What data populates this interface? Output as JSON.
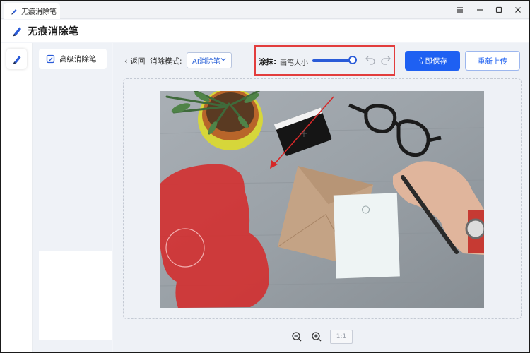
{
  "window": {
    "tab_title": "无痕消除笔",
    "icons": [
      "minimize-icon",
      "maximize-icon",
      "close-icon",
      "menu-icon"
    ]
  },
  "header": {
    "title": "无痕消除笔",
    "logo_icon": "pen-icon"
  },
  "sidebar": {
    "items": [
      {
        "label": "高级消除笔",
        "icon": "edit-icon"
      }
    ]
  },
  "toolbar": {
    "back_label": "返回",
    "mode_label": "消除模式:",
    "mode_value": "AI消除笔",
    "paint_label": "涂抹:",
    "brush_size_label": "画笔大小",
    "brush_size_level": 1.0,
    "save_label": "立即保存",
    "reupload_label": "重新上传"
  },
  "zoom": {
    "ratio_label": "1:1"
  },
  "colors": {
    "accent": "#1e60f2",
    "highlight_border": "#e23d3d",
    "brush_overlay": "#d62828"
  }
}
